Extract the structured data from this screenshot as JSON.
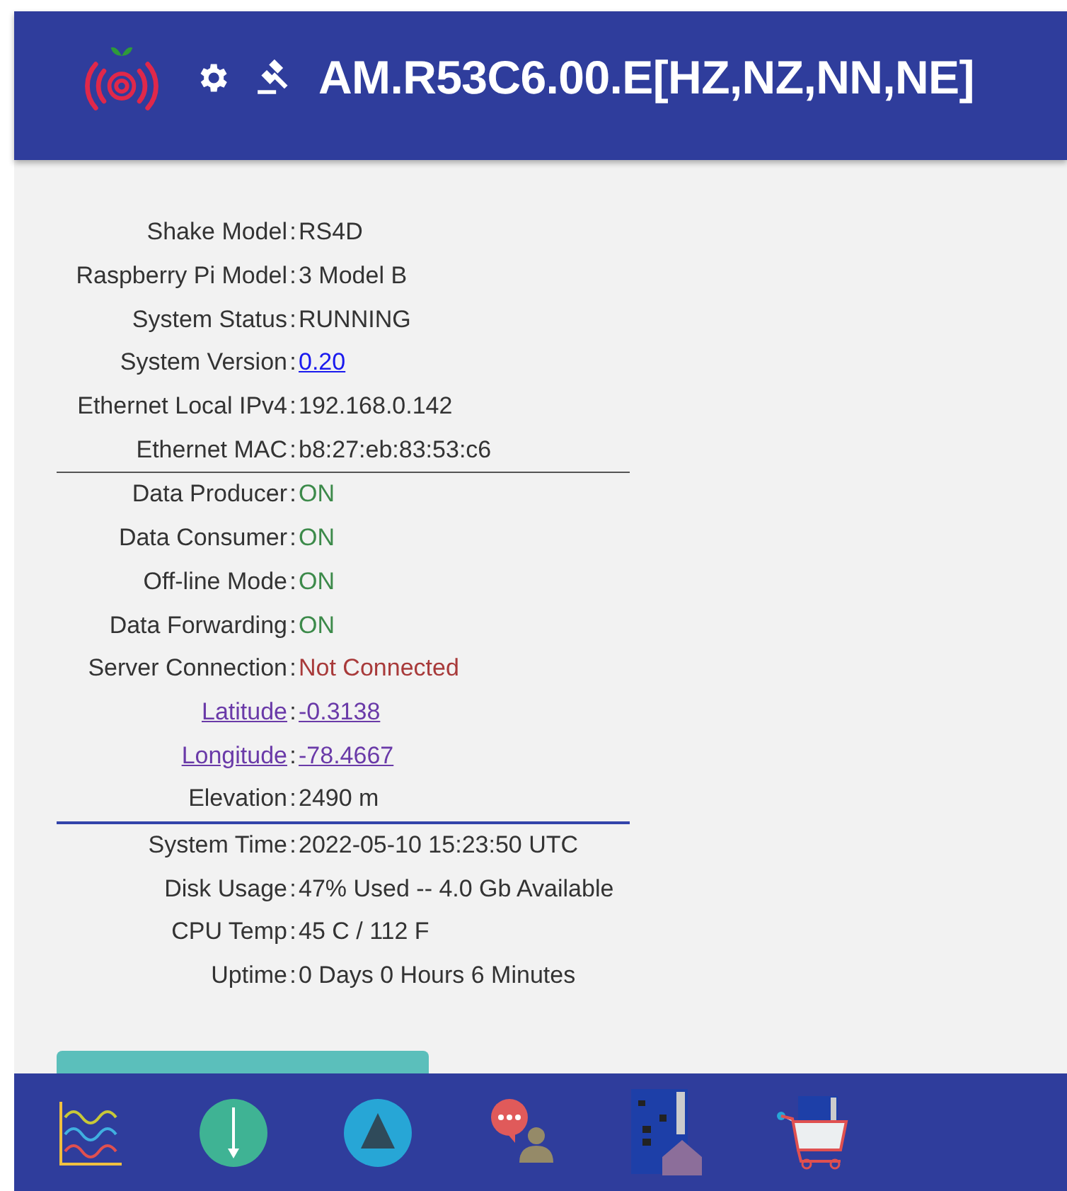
{
  "header": {
    "title": "AM.R53C6.00.E[HZ,NZ,NN,NE]"
  },
  "info_sections": [
    {
      "rows": [
        {
          "label": "Shake Model",
          "value": "RS4D",
          "kind": "plain"
        },
        {
          "label": "Raspberry Pi Model",
          "value": "3 Model B",
          "kind": "plain"
        },
        {
          "label": "System Status",
          "value": "RUNNING",
          "kind": "plain"
        },
        {
          "label": "System Version",
          "value": "0.20",
          "kind": "link"
        },
        {
          "label": "Ethernet Local IPv4",
          "value": "192.168.0.142",
          "kind": "plain"
        },
        {
          "label": "Ethernet MAC",
          "value": "b8:27:eb:83:53:c6",
          "kind": "plain"
        }
      ]
    },
    {
      "rows": [
        {
          "label": "Data Producer",
          "value": "ON",
          "kind": "good"
        },
        {
          "label": "Data Consumer",
          "value": "ON",
          "kind": "good"
        },
        {
          "label": "Off-line Mode",
          "value": "ON",
          "kind": "good"
        },
        {
          "label": "Data Forwarding",
          "value": "ON",
          "kind": "good"
        },
        {
          "label": "Server Connection",
          "value": "Not Connected",
          "kind": "bad"
        },
        {
          "label": "Latitude",
          "value": "-0.3138",
          "kind": "geo"
        },
        {
          "label": "Longitude",
          "value": "-78.4667",
          "kind": "geo"
        },
        {
          "label": "Elevation",
          "value": "2490 m",
          "kind": "plain"
        }
      ]
    },
    {
      "rows": [
        {
          "label": "System Time",
          "value": "2022-05-10 15:23:50 UTC",
          "kind": "plain"
        },
        {
          "label": "Disk Usage",
          "value": "47% Used -- 4.0 Gb Available",
          "kind": "plain"
        },
        {
          "label": "CPU Temp",
          "value": "45 C / 112 F",
          "kind": "plain"
        },
        {
          "label": "Uptime",
          "value": "0 Days 0 Hours 6 Minutes",
          "kind": "plain"
        }
      ]
    }
  ],
  "colon": ":"
}
